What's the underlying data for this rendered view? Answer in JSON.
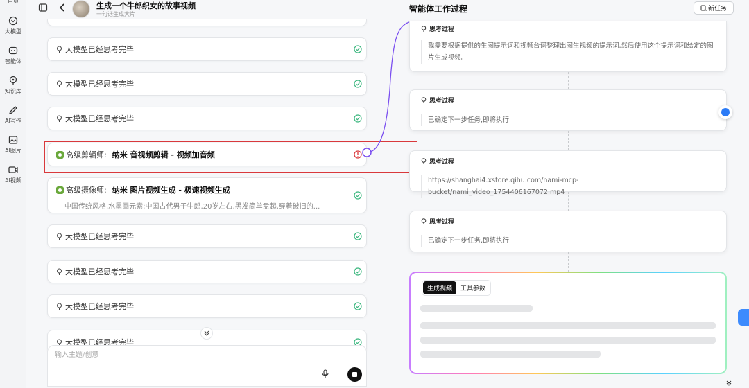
{
  "nav": {
    "top_label": "首页",
    "items": [
      {
        "label": "大模型",
        "icon": "model-icon"
      },
      {
        "label": "智能体",
        "icon": "agent-icon"
      },
      {
        "label": "知识库",
        "icon": "knowledge-icon"
      },
      {
        "label": "AI写作",
        "icon": "pen-icon"
      },
      {
        "label": "AI图片",
        "icon": "image-icon"
      },
      {
        "label": "AI视频",
        "icon": "video-icon"
      }
    ]
  },
  "header": {
    "title": "生成一个牛郎织女的故事视频",
    "subtitle": "一句话生成大片"
  },
  "steps": [
    {
      "type": "think",
      "label": "大模型已经思考完毕"
    },
    {
      "type": "think",
      "label": "大模型已经思考完毕"
    },
    {
      "type": "think",
      "label": "大模型已经思考完毕"
    },
    {
      "type": "agent",
      "role": "高级剪辑师:",
      "task": "纳米 音视频剪辑 - 视频加音频",
      "status": "error"
    },
    {
      "type": "agent",
      "role": "高级摄像师:",
      "task": "纳米 图片视频生成 - 极速视频生成",
      "desc": "中国传统风格,水墨画元素;中国古代男子牛郎,20岁左右,黑发简单盘起,穿着破旧的...",
      "status": "done"
    },
    {
      "type": "think",
      "label": "大模型已经思考完毕"
    },
    {
      "type": "think",
      "label": "大模型已经思考完毕"
    },
    {
      "type": "think",
      "label": "大模型已经思考完毕"
    },
    {
      "type": "think",
      "label": "大模型已经思考完毕"
    }
  ],
  "input": {
    "placeholder": "输入主题/创意"
  },
  "panel": {
    "title": "智能体工作过程",
    "new_task": "新任务",
    "thoughts": [
      {
        "header": "思考过程",
        "body": "我需要根据提供的生图提示词和视频台词整理出图生视频的提示词,然后使用这个提示词和给定的图片生成视频。"
      },
      {
        "header": "思考过程",
        "body": "已确定下一步任务,即将执行"
      },
      {
        "header": "思考过程",
        "body": "https://shanghai4.xstore.qihu.com/nami-mcp-bucket/nami_video_1754406167072.mp4"
      },
      {
        "header": "思考过程",
        "body": "已确定下一步任务,即将执行"
      }
    ],
    "tabs": [
      "生成视频",
      "工具参数"
    ]
  },
  "colors": {
    "accent_red": "#d9393c",
    "success_green": "#3bb77e",
    "connector_purple": "#7b4ff0",
    "brand_blue": "#2b7bf6"
  }
}
